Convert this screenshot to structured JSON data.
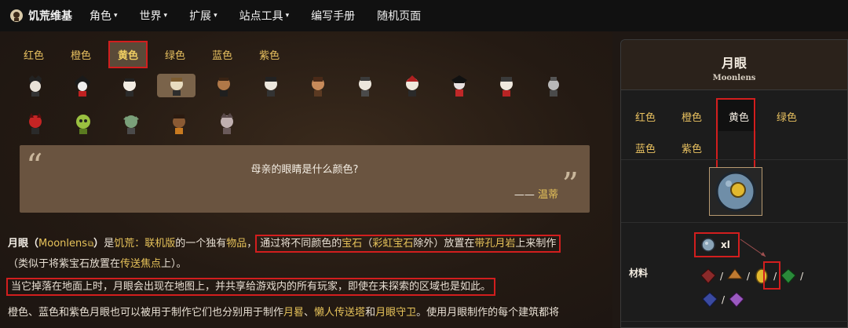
{
  "nav": {
    "site_name": "饥荒维基",
    "items": [
      {
        "label": "角色",
        "caret": "▾"
      },
      {
        "label": "世界",
        "caret": "▾"
      },
      {
        "label": "扩展",
        "caret": "▾"
      },
      {
        "label": "站点工具",
        "caret": "▾"
      },
      {
        "label": "编写手册",
        "caret": ""
      },
      {
        "label": "随机页面",
        "caret": ""
      }
    ]
  },
  "main": {
    "color_tabs": [
      "红色",
      "橙色",
      "黄色",
      "绿色",
      "蓝色",
      "紫色"
    ],
    "active_color_tab": "黄色",
    "quote": {
      "open_mark": "“",
      "close_mark": "”",
      "text": "母亲的眼睛是什么颜色?",
      "dash": "—— ",
      "author": "温蒂"
    },
    "para1": {
      "name": "月眼",
      "paren_open": "（",
      "name_en": "Moonlens",
      "paren_close": "）",
      "t1": "是",
      "game": "饥荒：联机版",
      "t2": "的一个独有",
      "item": "物品",
      "t3": "，",
      "box_t1": "通过将不同颜色的",
      "gem": "宝石",
      "box_t2": "（",
      "rainbow": "彩虹宝石",
      "box_t3": "除外）放置在",
      "rock": "带孔月岩",
      "box_t4": "上来制作"
    },
    "para1b": {
      "t1": "（类似于将紫宝石放置在",
      "focus": "传送焦点",
      "t2": "上）。"
    },
    "para2": "当它掉落在地面上时，月眼会出现在地图上，并共享给游戏内的所有玩家，即使在未探索的区域也是如此。",
    "para3": {
      "t1": "橙色、蓝色和紫色月眼也可以被用于制作它们也分别用于制作",
      "l1": "月晷",
      "t2": "、",
      "l2": "懒人传送塔",
      "t3": "和",
      "l3": "月眼守卫",
      "t4": "。使用月眼制作的每个建筑都将"
    }
  },
  "panel": {
    "title": "月眼",
    "subtitle": "Moonlens",
    "tabs": [
      "红色",
      "橙色",
      "黄色",
      "绿色",
      "蓝色",
      "紫色"
    ],
    "active_tab": "黄色",
    "materials_label": "材料",
    "material_main_qty": "xl",
    "separator": "/"
  },
  "colors": {
    "accent_yellow": "#e7c35a",
    "annotation_red": "#d21e1e",
    "nav_bg": "#111111",
    "panel_bg": "#1c1c1c"
  }
}
